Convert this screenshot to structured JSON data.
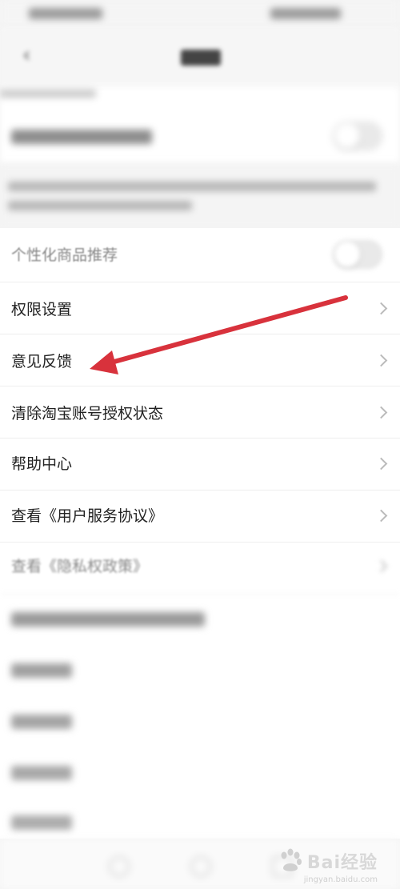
{
  "settings_list": {
    "items": [
      {
        "label": "个性化商品推荐"
      },
      {
        "label": "权限设置"
      },
      {
        "label": "意见反馈"
      },
      {
        "label": "清除淘宝账号授权状态"
      },
      {
        "label": "帮助中心"
      },
      {
        "label": "查看《用户服务协议》"
      },
      {
        "label": "查看《隐私权政策》"
      }
    ]
  },
  "watermark": {
    "text": "Bai经验",
    "sub": "jingyan.baidu.com"
  },
  "annotation": {
    "color": "#d8323c"
  }
}
